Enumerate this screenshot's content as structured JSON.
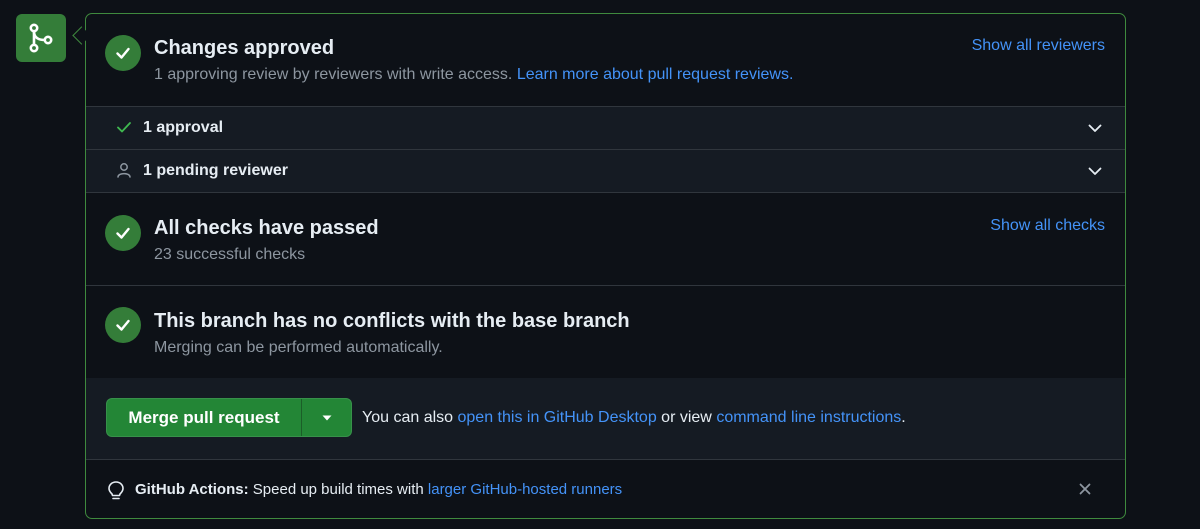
{
  "review": {
    "title": "Changes approved",
    "subtitle": "1 approving review by reviewers with write access.",
    "learn_more": "Learn more about pull request reviews.",
    "show_all": "Show all reviewers",
    "approval_row": "1 approval",
    "pending_row": "1 pending reviewer"
  },
  "checks": {
    "title": "All checks have passed",
    "subtitle": "23 successful checks",
    "show_all": "Show all checks"
  },
  "conflicts": {
    "title": "This branch has no conflicts with the base branch",
    "subtitle": "Merging can be performed automatically."
  },
  "merge": {
    "button_label": "Merge pull request",
    "hint_prefix": "You can also",
    "desktop_link": "open this in GitHub Desktop",
    "hint_middle": "or view",
    "cli_link": "command line instructions",
    "hint_suffix": "."
  },
  "footer": {
    "label": "GitHub Actions:",
    "text": "Speed up build times with",
    "link": "larger GitHub-hosted runners"
  },
  "colors": {
    "success": "#347d39",
    "link": "#4493f8",
    "border_success": "#3f8a3e"
  },
  "icons": [
    "git-merge-icon",
    "check-circle-icon",
    "check-icon",
    "person-icon",
    "chevron-down-icon",
    "triangle-down-icon",
    "light-bulb-icon",
    "close-icon"
  ]
}
